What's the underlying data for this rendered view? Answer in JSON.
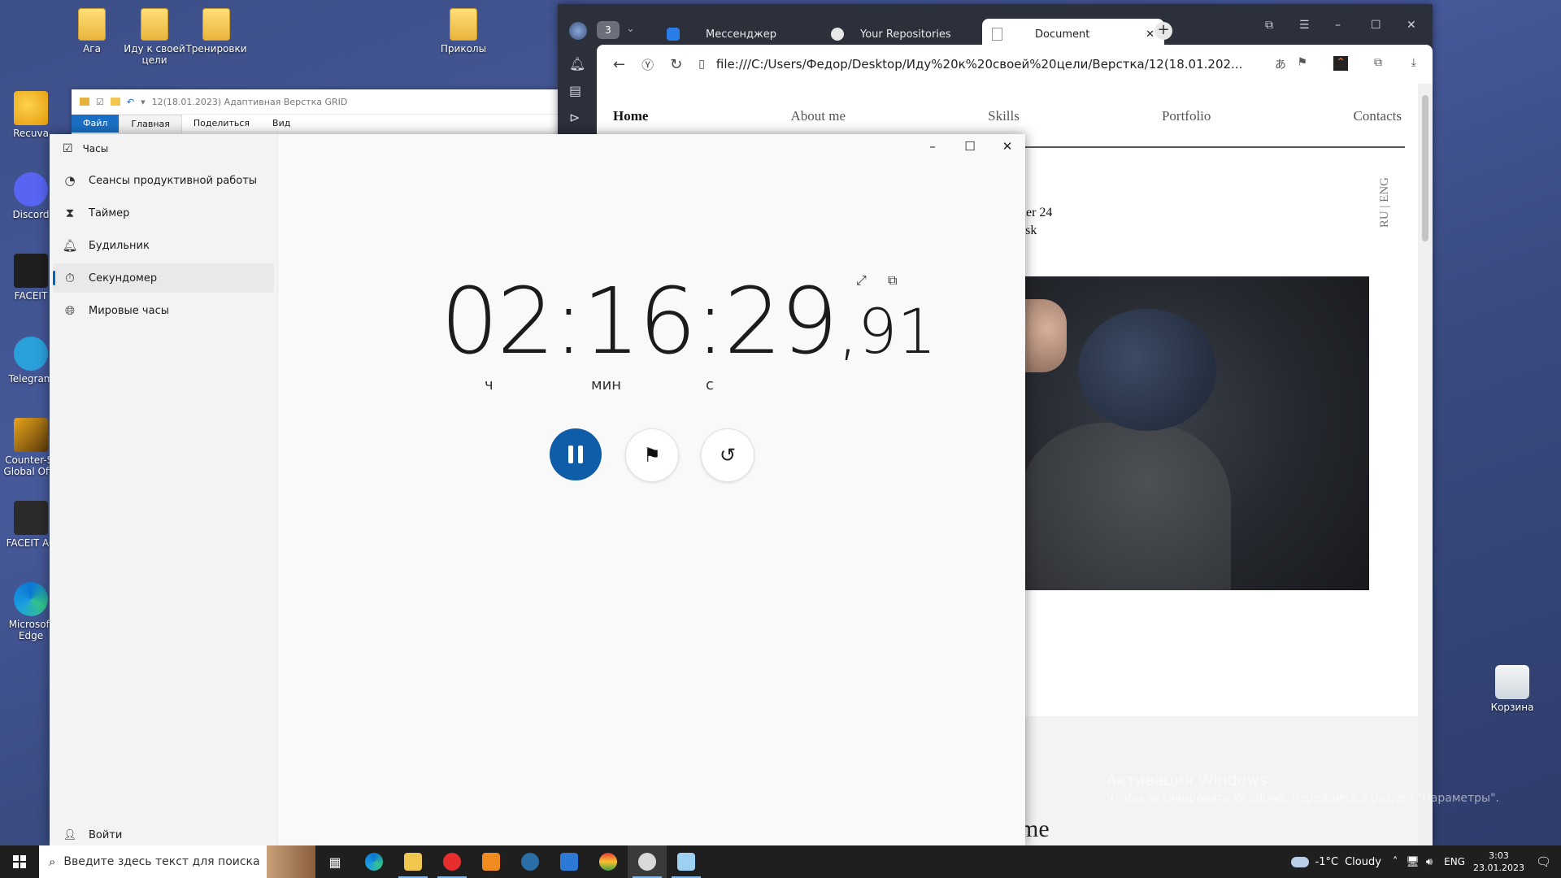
{
  "desktop": {
    "icons_top": [
      {
        "label": "Ага",
        "kind": "folder"
      },
      {
        "label": "Иду к своей цели",
        "kind": "folder"
      },
      {
        "label": "Тренировки",
        "kind": "folder"
      },
      {
        "label": "Приколы",
        "kind": "folder"
      }
    ],
    "icons_left": [
      {
        "label": "Recuva",
        "kind": "recuva"
      },
      {
        "label": "Discord",
        "kind": "discord"
      },
      {
        "label": "FACEIT",
        "kind": "faceit"
      },
      {
        "label": "Telegram",
        "kind": "telegram"
      },
      {
        "label": "Counter-St Global Offe",
        "kind": "csgo"
      },
      {
        "label": "FACEIT AC",
        "kind": "faceitac"
      },
      {
        "label": "Microsoft Edge",
        "kind": "edge"
      }
    ],
    "recycle_bin": "Корзина",
    "watermark": {
      "title": "Активация Windows",
      "text": "Чтобы активировать Windows, перейдите в раздел \"Параметры\"."
    }
  },
  "explorer": {
    "title": "12(18.01.2023) Адаптивная Верстка GRID",
    "ribbon": [
      "Файл",
      "Главная",
      "Поделиться",
      "Вид"
    ]
  },
  "browser": {
    "tab_count": "3",
    "tabs": [
      {
        "label": "Мессенджер",
        "icon": "messenger-icon"
      },
      {
        "label": "Your Repositories",
        "icon": "github-icon"
      },
      {
        "label": "Document",
        "icon": "document-icon"
      }
    ],
    "url": "file:///C:/Users/Федор/Desktop/Иду%20к%20своей%20цели/Верстка/12(18.01.202...",
    "page": {
      "menu": [
        "Home",
        "About me",
        "Skills",
        "Portfolio",
        "Contacts"
      ],
      "lang": "RU | ENG",
      "snippet_1": "ner 24",
      "snippet_2": "ask",
      "footer_text": "me"
    }
  },
  "clock_app": {
    "title": "Часы",
    "nav": [
      {
        "label": "Сеансы продуктивной работы",
        "icon": "focus-session-icon"
      },
      {
        "label": "Таймер",
        "icon": "hourglass-icon"
      },
      {
        "label": "Будильник",
        "icon": "bell-icon"
      },
      {
        "label": "Секундомер",
        "icon": "stopwatch-icon",
        "selected": true
      },
      {
        "label": "Мировые часы",
        "icon": "globe-icon"
      }
    ],
    "signin": "Войти",
    "stopwatch": {
      "time_main": "02:16:29",
      "time_fraction": ",91",
      "unit_hours": "ч",
      "unit_minutes": "мин",
      "unit_seconds": "с"
    }
  },
  "taskbar": {
    "search_placeholder": "Введите здесь текст для поиска",
    "weather_temp": "-1°C",
    "weather_text": "Cloudy",
    "language": "ENG",
    "time": "3:03",
    "date": "23.01.2023"
  }
}
